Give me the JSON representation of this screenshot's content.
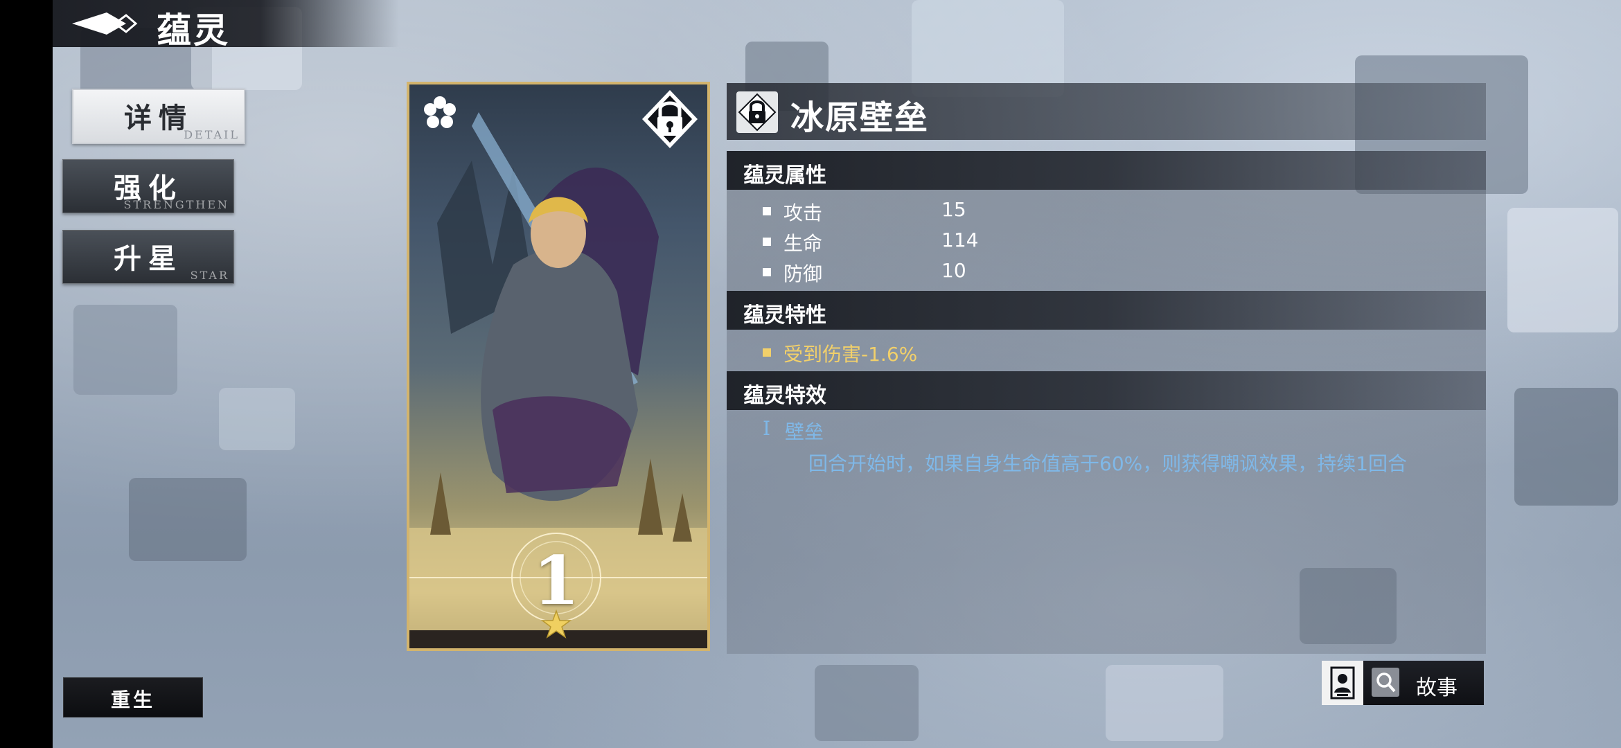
{
  "header": {
    "title": "蕴灵"
  },
  "tabs": [
    {
      "label": "详情",
      "sub": "DETAIL",
      "active": true
    },
    {
      "label": "强化",
      "sub": "STRENGTHEN",
      "active": false
    },
    {
      "label": "升星",
      "sub": "STAR",
      "active": false
    }
  ],
  "card": {
    "star_level": "1"
  },
  "detail": {
    "name": "冰原壁垒",
    "attributes_title": "蕴灵属性",
    "stats": [
      {
        "label": "攻击",
        "value": "15"
      },
      {
        "label": "生命",
        "value": "114"
      },
      {
        "label": "防御",
        "value": "10"
      }
    ],
    "traits_title": "蕴灵特性",
    "trait": "受到伤害-1.6%",
    "effects_title": "蕴灵特效",
    "effect": {
      "numeral": "I",
      "name": "壁垒",
      "description": "回合开始时，如果自身生命值高于60%，则获得嘲讽效果，持续1回合"
    }
  },
  "buttons": {
    "rebirth": "重生",
    "story": "故事"
  },
  "colors": {
    "card_border": "#d3b46d",
    "trait_color": "#f2d06a",
    "effect_color": "#7fb8e8"
  }
}
